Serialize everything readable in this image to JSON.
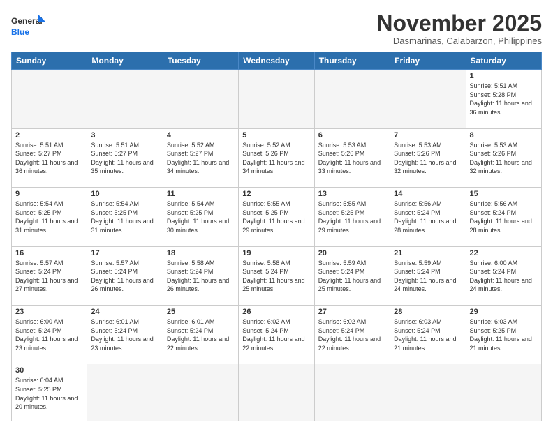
{
  "header": {
    "logo_general": "General",
    "logo_blue": "Blue",
    "month_title": "November 2025",
    "location": "Dasmarinas, Calabarzon, Philippines"
  },
  "days_of_week": [
    "Sunday",
    "Monday",
    "Tuesday",
    "Wednesday",
    "Thursday",
    "Friday",
    "Saturday"
  ],
  "weeks": [
    [
      {
        "day": "",
        "empty": true
      },
      {
        "day": "",
        "empty": true
      },
      {
        "day": "",
        "empty": true
      },
      {
        "day": "",
        "empty": true
      },
      {
        "day": "",
        "empty": true
      },
      {
        "day": "",
        "empty": true
      },
      {
        "day": "1",
        "sunrise": "5:51 AM",
        "sunset": "5:28 PM",
        "daylight": "11 hours and 36 minutes."
      }
    ],
    [
      {
        "day": "2",
        "sunrise": "5:51 AM",
        "sunset": "5:27 PM",
        "daylight": "11 hours and 36 minutes."
      },
      {
        "day": "3",
        "sunrise": "5:51 AM",
        "sunset": "5:27 PM",
        "daylight": "11 hours and 35 minutes."
      },
      {
        "day": "4",
        "sunrise": "5:52 AM",
        "sunset": "5:27 PM",
        "daylight": "11 hours and 34 minutes."
      },
      {
        "day": "5",
        "sunrise": "5:52 AM",
        "sunset": "5:26 PM",
        "daylight": "11 hours and 34 minutes."
      },
      {
        "day": "6",
        "sunrise": "5:53 AM",
        "sunset": "5:26 PM",
        "daylight": "11 hours and 33 minutes."
      },
      {
        "day": "7",
        "sunrise": "5:53 AM",
        "sunset": "5:26 PM",
        "daylight": "11 hours and 32 minutes."
      },
      {
        "day": "8",
        "sunrise": "5:53 AM",
        "sunset": "5:26 PM",
        "daylight": "11 hours and 32 minutes."
      }
    ],
    [
      {
        "day": "9",
        "sunrise": "5:54 AM",
        "sunset": "5:25 PM",
        "daylight": "11 hours and 31 minutes."
      },
      {
        "day": "10",
        "sunrise": "5:54 AM",
        "sunset": "5:25 PM",
        "daylight": "11 hours and 31 minutes."
      },
      {
        "day": "11",
        "sunrise": "5:54 AM",
        "sunset": "5:25 PM",
        "daylight": "11 hours and 30 minutes."
      },
      {
        "day": "12",
        "sunrise": "5:55 AM",
        "sunset": "5:25 PM",
        "daylight": "11 hours and 29 minutes."
      },
      {
        "day": "13",
        "sunrise": "5:55 AM",
        "sunset": "5:25 PM",
        "daylight": "11 hours and 29 minutes."
      },
      {
        "day": "14",
        "sunrise": "5:56 AM",
        "sunset": "5:24 PM",
        "daylight": "11 hours and 28 minutes."
      },
      {
        "day": "15",
        "sunrise": "5:56 AM",
        "sunset": "5:24 PM",
        "daylight": "11 hours and 28 minutes."
      }
    ],
    [
      {
        "day": "16",
        "sunrise": "5:57 AM",
        "sunset": "5:24 PM",
        "daylight": "11 hours and 27 minutes."
      },
      {
        "day": "17",
        "sunrise": "5:57 AM",
        "sunset": "5:24 PM",
        "daylight": "11 hours and 26 minutes."
      },
      {
        "day": "18",
        "sunrise": "5:58 AM",
        "sunset": "5:24 PM",
        "daylight": "11 hours and 26 minutes."
      },
      {
        "day": "19",
        "sunrise": "5:58 AM",
        "sunset": "5:24 PM",
        "daylight": "11 hours and 25 minutes."
      },
      {
        "day": "20",
        "sunrise": "5:59 AM",
        "sunset": "5:24 PM",
        "daylight": "11 hours and 25 minutes."
      },
      {
        "day": "21",
        "sunrise": "5:59 AM",
        "sunset": "5:24 PM",
        "daylight": "11 hours and 24 minutes."
      },
      {
        "day": "22",
        "sunrise": "6:00 AM",
        "sunset": "5:24 PM",
        "daylight": "11 hours and 24 minutes."
      }
    ],
    [
      {
        "day": "23",
        "sunrise": "6:00 AM",
        "sunset": "5:24 PM",
        "daylight": "11 hours and 23 minutes."
      },
      {
        "day": "24",
        "sunrise": "6:01 AM",
        "sunset": "5:24 PM",
        "daylight": "11 hours and 23 minutes."
      },
      {
        "day": "25",
        "sunrise": "6:01 AM",
        "sunset": "5:24 PM",
        "daylight": "11 hours and 22 minutes."
      },
      {
        "day": "26",
        "sunrise": "6:02 AM",
        "sunset": "5:24 PM",
        "daylight": "11 hours and 22 minutes."
      },
      {
        "day": "27",
        "sunrise": "6:02 AM",
        "sunset": "5:24 PM",
        "daylight": "11 hours and 22 minutes."
      },
      {
        "day": "28",
        "sunrise": "6:03 AM",
        "sunset": "5:24 PM",
        "daylight": "11 hours and 21 minutes."
      },
      {
        "day": "29",
        "sunrise": "6:03 AM",
        "sunset": "5:25 PM",
        "daylight": "11 hours and 21 minutes."
      }
    ],
    [
      {
        "day": "30",
        "sunrise": "6:04 AM",
        "sunset": "5:25 PM",
        "daylight": "11 hours and 20 minutes."
      },
      {
        "day": "",
        "empty": true
      },
      {
        "day": "",
        "empty": true
      },
      {
        "day": "",
        "empty": true
      },
      {
        "day": "",
        "empty": true
      },
      {
        "day": "",
        "empty": true
      },
      {
        "day": "",
        "empty": true
      }
    ]
  ]
}
